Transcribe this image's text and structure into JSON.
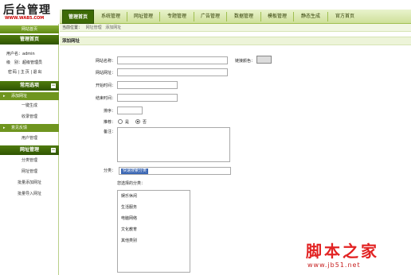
{
  "logo": {
    "title": "后台管理",
    "url": "WWW.WAB5.COM"
  },
  "topnav": {
    "tabs": [
      {
        "label": "管理首页",
        "active": true
      },
      {
        "label": "系统管理"
      },
      {
        "label": "网址管理"
      },
      {
        "label": "专题管理"
      },
      {
        "label": "广告管理"
      },
      {
        "label": "数据管理"
      },
      {
        "label": "模板管理"
      },
      {
        "label": "静态生成"
      },
      {
        "label": "官方首页"
      }
    ]
  },
  "sidebar": {
    "site_home": "网站首页",
    "admin_home": "管理首页",
    "username_label": "用户名：admin",
    "role_label": "级　别：超级管理员",
    "links": [
      "密码",
      "主页",
      "退出"
    ],
    "section_common": "常用选项",
    "common_items": [
      {
        "label": "添加网址",
        "group": true
      },
      {
        "label": "一键生成"
      },
      {
        "label": "收录管理"
      },
      {
        "label": "意见反馈",
        "group": true
      },
      {
        "label": "用户管理"
      }
    ],
    "section_urls": "网址管理",
    "url_items": [
      "分类管理",
      "网址管理",
      "批量添加网址",
      "批量导入网址"
    ],
    "toggle_symbol": "−"
  },
  "breadcrumb": {
    "prefix": "当前位置：",
    "items": [
      "网址管理",
      "添加网址"
    ]
  },
  "form": {
    "section_title": "添加网址",
    "labels": {
      "site_name": "网站名称：",
      "highlight_color": "链接颜色：",
      "site_url": "网站网址：",
      "start_time": "开始时间：",
      "end_time": "结束时间：",
      "sort": "排序：",
      "recommend": "推荐：",
      "remark": "备注：",
      "category": "分类：",
      "selected_categories": "您选择的分类："
    },
    "recommend_options": [
      {
        "label": "是",
        "checked": false
      },
      {
        "label": "否",
        "checked": true
      }
    ],
    "category_value": "快速搜索分类",
    "category_list": [
      "娱乐休闲",
      "生活服务",
      "电脑网络",
      "文化教育",
      "其他类别"
    ]
  },
  "watermark": {
    "main": "脚本之家",
    "url": "www.jb51.net"
  }
}
